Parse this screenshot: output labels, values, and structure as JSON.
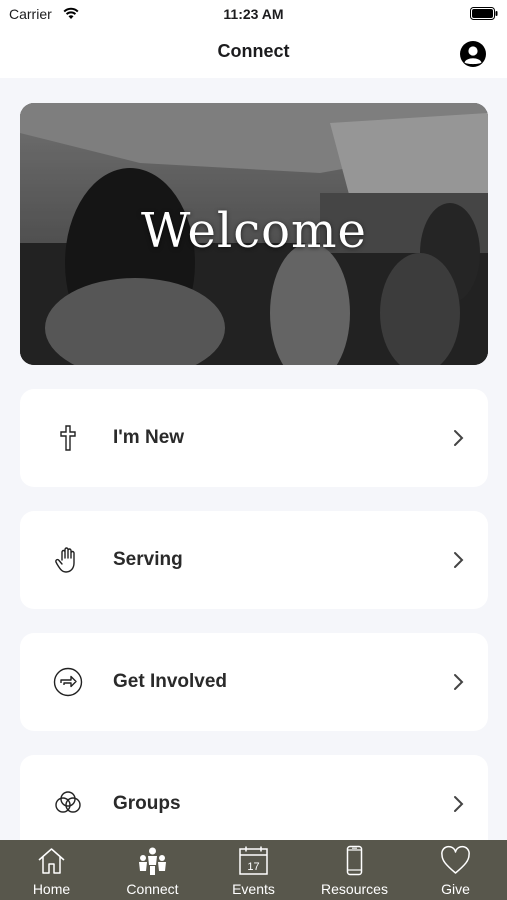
{
  "status_bar": {
    "carrier": "Carrier",
    "time": "11:23 AM"
  },
  "nav": {
    "title": "Connect"
  },
  "hero": {
    "title": "Welcome"
  },
  "cards": [
    {
      "label": "I'm New",
      "icon": "cross-icon"
    },
    {
      "label": "Serving",
      "icon": "hand-icon"
    },
    {
      "label": "Get Involved",
      "icon": "arrow-circle-icon"
    },
    {
      "label": "Groups",
      "icon": "circles-icon"
    }
  ],
  "tabs": [
    {
      "label": "Home",
      "icon": "home-icon"
    },
    {
      "label": "Connect",
      "icon": "people-icon",
      "active": true
    },
    {
      "label": "Events",
      "icon": "calendar-icon",
      "calendar_day": "17"
    },
    {
      "label": "Resources",
      "icon": "phone-icon"
    },
    {
      "label": "Give",
      "icon": "heart-icon"
    }
  ],
  "colors": {
    "tab_bar": "#58574c",
    "background": "#f5f6fa",
    "card": "#ffffff"
  }
}
